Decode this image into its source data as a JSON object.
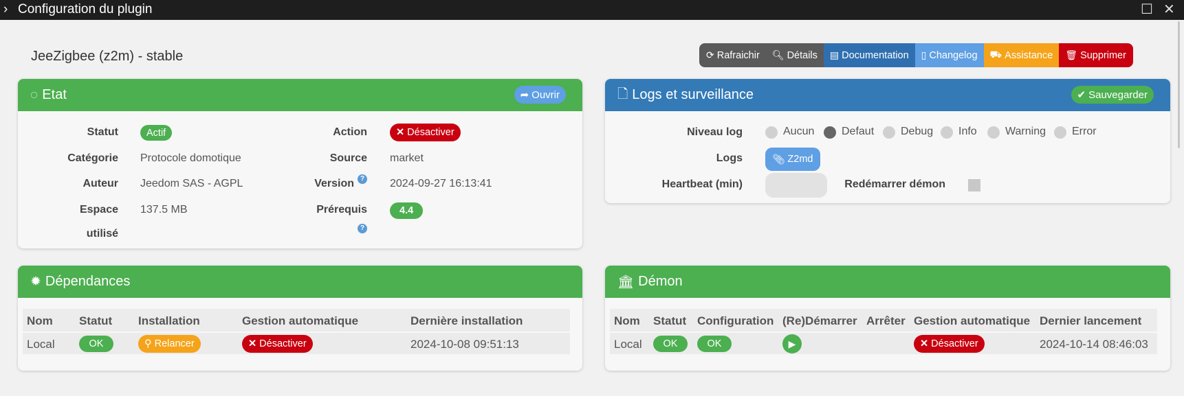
{
  "window": {
    "title": "Configuration du plugin"
  },
  "plugin": {
    "title": "JeeZigbee (z2m) - stable"
  },
  "actions": {
    "refresh": "Rafraichir",
    "details": "Détails",
    "documentation": "Documentation",
    "changelog": "Changelog",
    "assistance": "Assistance",
    "delete": "Supprimer"
  },
  "etat": {
    "title": "Etat",
    "open_btn": "Ouvrir",
    "statut_label": "Statut",
    "statut_value": "Actif",
    "categorie_label": "Catégorie",
    "categorie_value": "Protocole domotique",
    "auteur_label": "Auteur",
    "auteur_value": "Jeedom SAS - AGPL",
    "espace_label_1": "Espace",
    "espace_label_2": "utilisé",
    "espace_value": "137.5 MB",
    "action_label": "Action",
    "action_btn": "Désactiver",
    "source_label": "Source",
    "source_value": "market",
    "version_label": "Version",
    "version_value": "2024-09-27 16:13:41",
    "prerequis_label": "Prérequis",
    "prerequis_value": "4.4"
  },
  "logs": {
    "title": "Logs et surveillance",
    "save_btn": "Sauvegarder",
    "niveau_label": "Niveau log",
    "levels": [
      "Aucun",
      "Defaut",
      "Debug",
      "Info",
      "Warning",
      "Error"
    ],
    "selected_level": "Defaut",
    "logs_label": "Logs",
    "logs_btn": "Z2md",
    "heartbeat_label": "Heartbeat (min)",
    "heartbeat_value": "",
    "restart_label": "Redémarrer démon"
  },
  "dependances": {
    "title": "Dépendances",
    "headers": [
      "Nom",
      "Statut",
      "Installation",
      "Gestion automatique",
      "Dernière installation"
    ],
    "row": {
      "nom": "Local",
      "statut": "OK",
      "installation": "Relancer",
      "gestion": "Désactiver",
      "derniere": "2024-10-08 09:51:13"
    }
  },
  "demon": {
    "title": "Démon",
    "headers": [
      "Nom",
      "Statut",
      "Configuration",
      "(Re)Démarrer",
      "Arrêter",
      "Gestion automatique",
      "Dernier lancement"
    ],
    "row": {
      "nom": "Local",
      "statut": "OK",
      "configuration": "OK",
      "gestion": "Désactiver",
      "dernier": "2024-10-14 08:46:03"
    }
  },
  "colors": {
    "green": "#4caf50",
    "blue_header": "#337ab7",
    "red": "#c8000f",
    "orange": "#f5a31a",
    "dark_grey": "#5a5a5a",
    "doc_blue": "#2f6fb0",
    "changelog_blue": "#5f9fe3"
  }
}
